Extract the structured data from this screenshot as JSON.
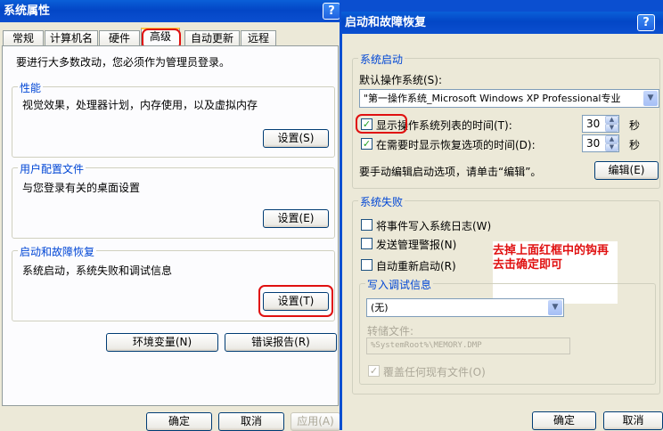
{
  "left_window": {
    "title": "系统属性",
    "help_button": "?",
    "tabs": [
      "常规",
      "计算机名",
      "硬件",
      "高级",
      "自动更新",
      "远程"
    ],
    "notice": "要进行大多数改动，您必须作为管理员登录。",
    "performance": {
      "title": "性能",
      "desc": "视觉效果，处理器计划，内存使用，以及虚拟内存",
      "button": "设置(S)"
    },
    "user_profiles": {
      "title": "用户配置文件",
      "desc": "与您登录有关的桌面设置",
      "button": "设置(E)"
    },
    "startup_recovery": {
      "title": "启动和故障恢复",
      "desc": "系统启动，系统失败和调试信息",
      "button": "设置(T)"
    },
    "env_button": "环境变量(N)",
    "error_button": "错误报告(R)",
    "ok": "确定",
    "cancel": "取消",
    "apply": "应用(A)"
  },
  "right_window": {
    "title": "启动和故障恢复",
    "help_button": "?",
    "system_startup": {
      "title": "系统启动",
      "default_os_label": "默认操作系统(S):",
      "default_os_value": "\"第一操作系统_Microsoft Windows XP Professional专业",
      "show_list_label": "显示操作系统列表的时间(T):",
      "show_list_value": "30",
      "show_recovery_label": "在需要时显示恢复选项的时间(D):",
      "show_recovery_value": "30",
      "seconds": "秒",
      "edit_hint": "要手动编辑启动选项，请单击“编辑”。",
      "edit_button": "编辑(E)"
    },
    "system_failure": {
      "title": "系统失败",
      "write_event": "将事件写入系统日志(W)",
      "send_alert": "发送管理警报(N)",
      "auto_restart": "自动重新启动(R)",
      "debug_title": "写入调试信息",
      "debug_value": "(无)",
      "dump_label": "转储文件:",
      "dump_value": "%SystemRoot%\\MEMORY.DMP",
      "overwrite": "覆盖任何现有文件(O)"
    },
    "annotation": "去掉上面红框中的钩再去击确定即可",
    "ok": "确定",
    "cancel": "取消"
  },
  "colors": {
    "title_blue": "#0346c6",
    "group_title": "#0046d5",
    "annotation_red": "#e01010"
  }
}
